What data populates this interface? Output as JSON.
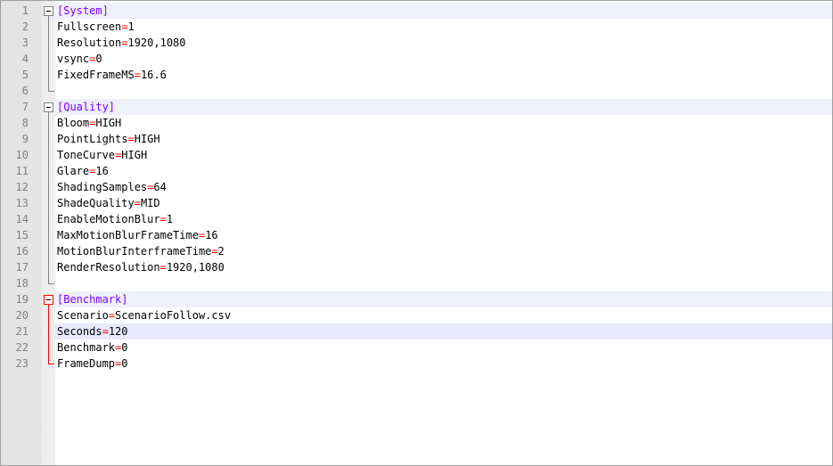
{
  "editor": {
    "lines": [
      {
        "n": "1",
        "type": "section",
        "text": "[System]"
      },
      {
        "n": "2",
        "type": "kv",
        "key": "Fullscreen",
        "eq": "=",
        "value": "1"
      },
      {
        "n": "3",
        "type": "kv",
        "key": "Resolution",
        "eq": "=",
        "value": "1920,1080"
      },
      {
        "n": "4",
        "type": "kv",
        "key": "vsync",
        "eq": "=",
        "value": "0"
      },
      {
        "n": "5",
        "type": "kv",
        "key": "FixedFrameMS",
        "eq": "=",
        "value": "16.6"
      },
      {
        "n": "6",
        "type": "blank"
      },
      {
        "n": "7",
        "type": "section",
        "text": "[Quality]"
      },
      {
        "n": "8",
        "type": "kv",
        "key": "Bloom",
        "eq": "=",
        "value": "HIGH"
      },
      {
        "n": "9",
        "type": "kv",
        "key": "PointLights",
        "eq": "=",
        "value": "HIGH"
      },
      {
        "n": "10",
        "type": "kv",
        "key": "ToneCurve",
        "eq": "=",
        "value": "HIGH"
      },
      {
        "n": "11",
        "type": "kv",
        "key": "Glare",
        "eq": "=",
        "value": "16"
      },
      {
        "n": "12",
        "type": "kv",
        "key": "ShadingSamples",
        "eq": "=",
        "value": "64"
      },
      {
        "n": "13",
        "type": "kv",
        "key": "ShadeQuality",
        "eq": "=",
        "value": "MID"
      },
      {
        "n": "14",
        "type": "kv",
        "key": "EnableMotionBlur",
        "eq": "=",
        "value": "1"
      },
      {
        "n": "15",
        "type": "kv",
        "key": "MaxMotionBlurFrameTime",
        "eq": "=",
        "value": "16"
      },
      {
        "n": "16",
        "type": "kv",
        "key": "MotionBlurInterframeTime",
        "eq": "=",
        "value": "2"
      },
      {
        "n": "17",
        "type": "kv",
        "key": "RenderResolution",
        "eq": "=",
        "value": "1920,1080"
      },
      {
        "n": "18",
        "type": "blank"
      },
      {
        "n": "19",
        "type": "section",
        "text": "[Benchmark]"
      },
      {
        "n": "20",
        "type": "kv",
        "key": "Scenario",
        "eq": "=",
        "value": "ScenarioFollow.csv"
      },
      {
        "n": "21",
        "type": "kv",
        "key": "Seconds",
        "eq": "=",
        "value": "120"
      },
      {
        "n": "22",
        "type": "kv",
        "key": "Benchmark",
        "eq": "=",
        "value": "0"
      },
      {
        "n": "23",
        "type": "kv",
        "key": "FrameDump",
        "eq": "=",
        "value": "0"
      }
    ],
    "current_line": "21",
    "colors": {
      "section": "#8000ff",
      "operator": "#ff0000",
      "line_number": "#808080",
      "gutter": "#e4e4e4",
      "current_line_bg": "#e8e8ff",
      "fold_active": "#ff0000"
    }
  }
}
